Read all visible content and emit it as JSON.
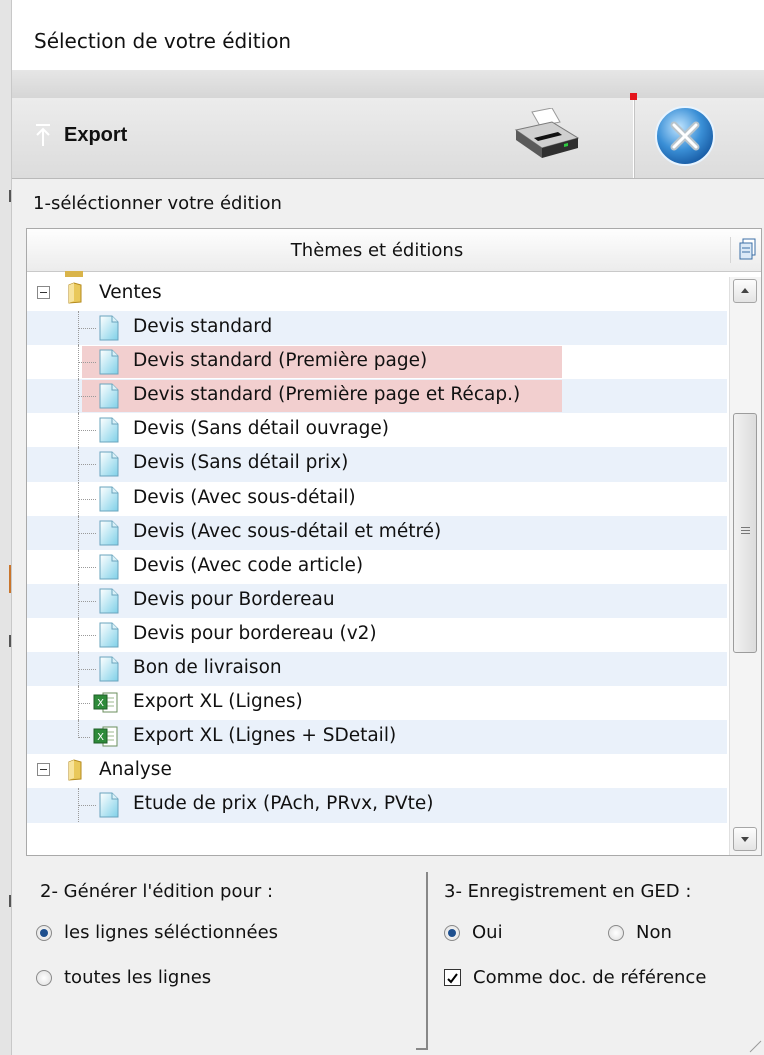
{
  "window": {
    "title": "Sélection de votre édition"
  },
  "toolbar": {
    "export_label": "Export",
    "icons": [
      "export-arrow-icon",
      "printer-icon",
      "close-icon"
    ]
  },
  "step1": {
    "label": "1-séléctionner votre édition"
  },
  "tree": {
    "header": "Thèmes et éditions",
    "rows": [
      {
        "label": "Ventes",
        "type": "folder",
        "expanded": true
      },
      {
        "label": "Devis standard",
        "type": "report"
      },
      {
        "label": "Devis standard (Première page)",
        "type": "report",
        "selected": true
      },
      {
        "label": "Devis standard (Première page et Récap.)",
        "type": "report",
        "selected": true
      },
      {
        "label": "Devis (Sans détail ouvrage)",
        "type": "report"
      },
      {
        "label": "Devis (Sans détail prix)",
        "type": "report"
      },
      {
        "label": "Devis (Avec sous-détail)",
        "type": "report"
      },
      {
        "label": "Devis (Avec sous-détail et métré)",
        "type": "report"
      },
      {
        "label": "Devis (Avec code article)",
        "type": "report"
      },
      {
        "label": "Devis pour Bordereau",
        "type": "report"
      },
      {
        "label": "Devis pour bordereau (v2)",
        "type": "report"
      },
      {
        "label": "Bon de livraison",
        "type": "report"
      },
      {
        "label": "Export XL (Lignes)",
        "type": "excel"
      },
      {
        "label": "Export XL (Lignes + SDetail)",
        "type": "excel"
      },
      {
        "label": "Analyse",
        "type": "folder",
        "expanded": true
      },
      {
        "label": "Etude de prix (PAch, PRvx, PVte)",
        "type": "report"
      }
    ]
  },
  "generate": {
    "label": "2- Générer l'édition pour :",
    "options": [
      "les lignes séléctionnées",
      "toutes les lignes"
    ],
    "selected": "les lignes séléctionnées"
  },
  "ged": {
    "label": "3- Enregistrement en GED :",
    "options": [
      "Oui",
      "Non"
    ],
    "selected": "Oui",
    "reference_label": "Comme doc. de référence",
    "reference_checked": true
  },
  "colors": {
    "selection_highlight": "#f2cfcf",
    "alt_row": "#eaf1fa",
    "close_blue": "#3a8fd6"
  }
}
